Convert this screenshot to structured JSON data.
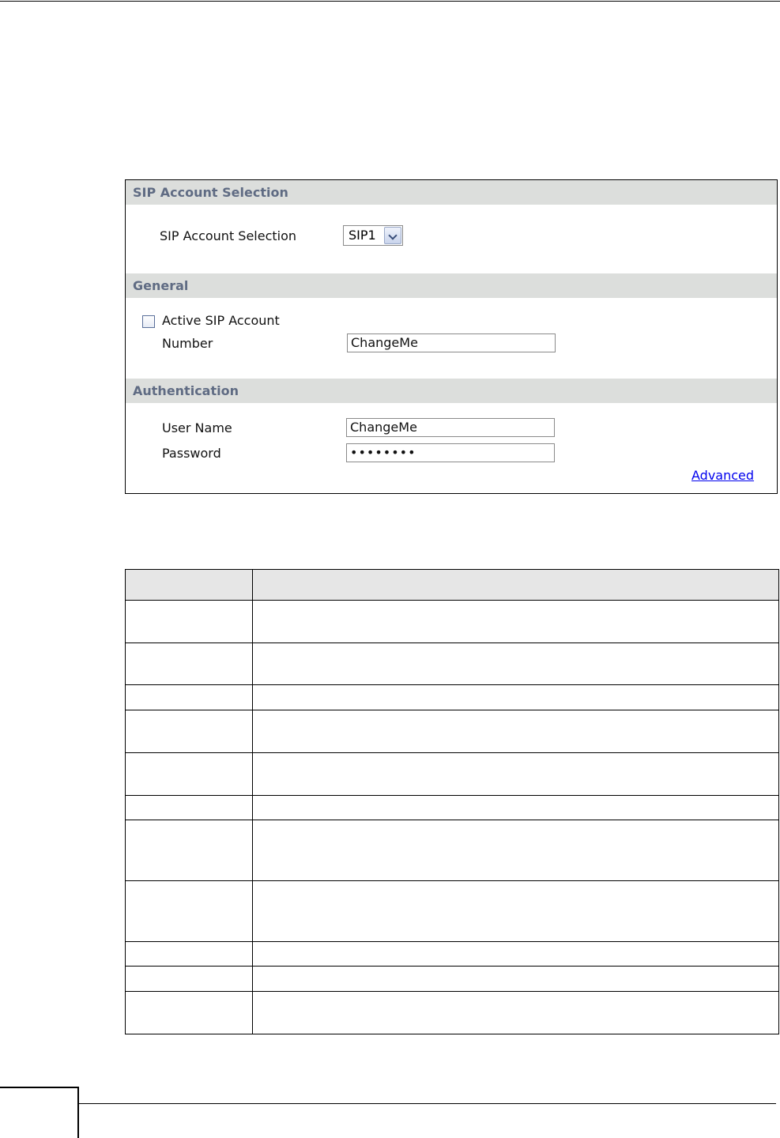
{
  "panel": {
    "section_selection": "SIP Account Selection",
    "selection_label": "SIP Account Selection",
    "selection_value": "SIP1",
    "section_general": "General",
    "active_label": "Active SIP Account",
    "active_checked": false,
    "number_label": "Number",
    "number_value": "ChangeMe",
    "section_auth": "Authentication",
    "username_label": "User Name",
    "username_value": "ChangeMe",
    "password_label": "Password",
    "password_value": "••••••••",
    "advanced_link": "Advanced"
  },
  "table": {
    "rows": [
      {
        "label": "",
        "desc": ""
      },
      {
        "label": "",
        "desc": ""
      },
      {
        "label": "",
        "desc": ""
      },
      {
        "label": "",
        "desc": ""
      },
      {
        "label": "",
        "desc": ""
      },
      {
        "label": "",
        "desc": ""
      },
      {
        "label": "",
        "desc": ""
      },
      {
        "label": "",
        "desc": ""
      },
      {
        "label": "",
        "desc": ""
      },
      {
        "label": "",
        "desc": ""
      },
      {
        "label": "",
        "desc": ""
      }
    ]
  }
}
